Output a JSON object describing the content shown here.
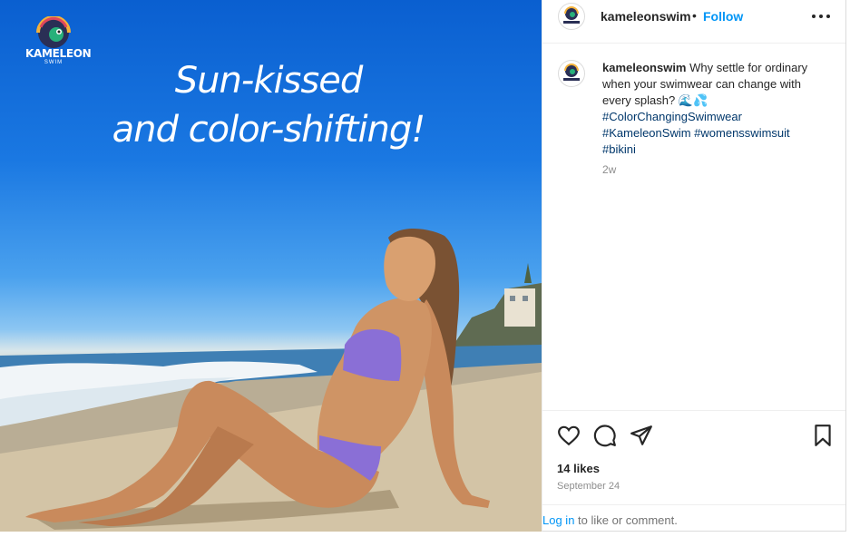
{
  "image": {
    "logo_text": "KAMELEON",
    "logo_sub": "SWIM",
    "headline_line1": "Sun-kissed",
    "headline_line2": "and color-shifting!"
  },
  "header": {
    "username": "kameleonswim",
    "separator": "•",
    "follow_label": "Follow",
    "more_icon": "more-horizontal-icon"
  },
  "caption": {
    "username": "kameleonswim",
    "text": "Why settle for ordinary when your swimwear can change with every splash? 🌊💦",
    "hashtags": [
      "#ColorChangingSwimwear",
      "#KameleonSwim",
      "#womensswimsuit",
      "#bikini"
    ],
    "age": "2w"
  },
  "actions": {
    "like_icon": "heart-icon",
    "comment_icon": "comment-icon",
    "share_icon": "send-icon",
    "save_icon": "bookmark-icon",
    "likes_text": "14 likes",
    "date": "September 24"
  },
  "login": {
    "link_text": "Log in",
    "rest_text": " to like or comment."
  },
  "colors": {
    "follow": "#0095f6",
    "hashtag": "#00376b",
    "bikini": "#8a6fd6"
  }
}
